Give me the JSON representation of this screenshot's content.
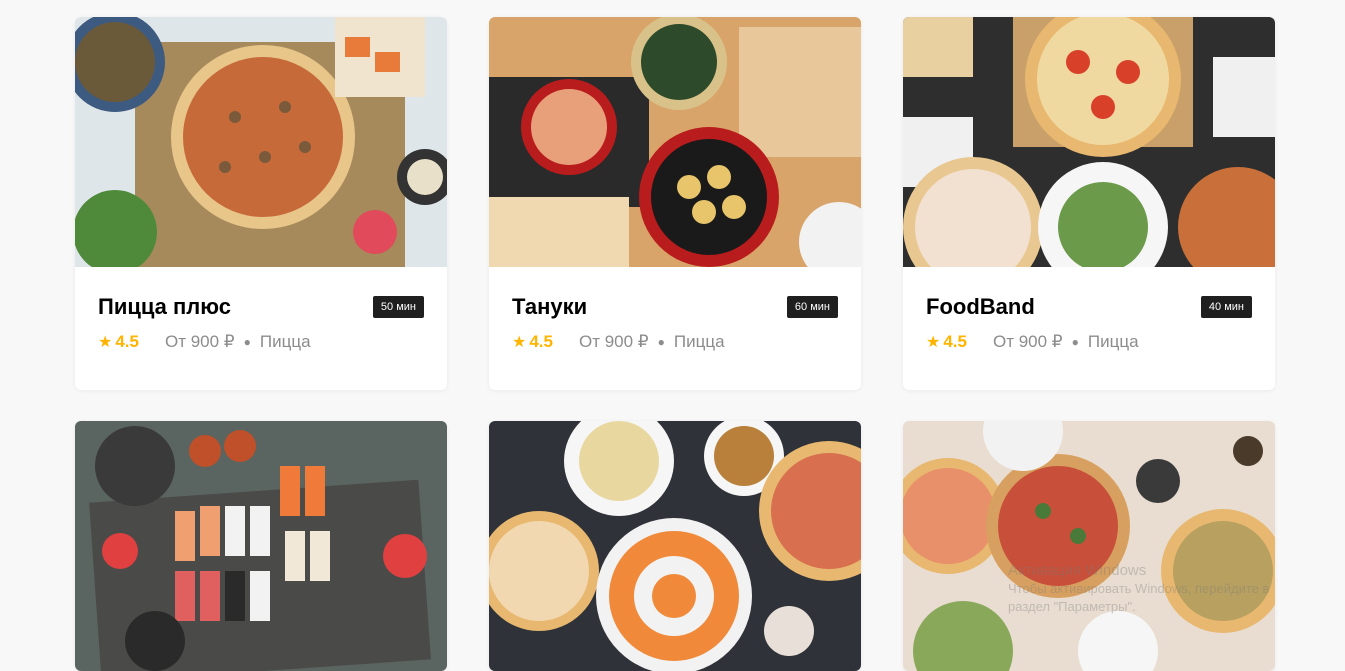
{
  "restaurants": [
    {
      "name": "Пицца плюс",
      "time": "50 мин",
      "rating": "4.5",
      "price": "От 900 ₽",
      "category": "Пицца",
      "image": "pizza-table-photo"
    },
    {
      "name": "Тануки",
      "time": "60 мин",
      "rating": "4.5",
      "price": "От 900 ₽",
      "category": "Пицца",
      "image": "asian-dishes-photo"
    },
    {
      "name": "FoodBand",
      "time": "40 мин",
      "rating": "4.5",
      "price": "От 900 ₽",
      "category": "Пицца",
      "image": "pizza-boxes-photo"
    },
    {
      "image": "sushi-board-photo"
    },
    {
      "image": "pizza-sushi-spread-photo"
    },
    {
      "image": "pizza-feast-photo"
    }
  ],
  "icons": {
    "star": "star-icon",
    "dot": "bullet-dot"
  },
  "colors": {
    "star": "#ffb400",
    "badge": "#1f1f1f",
    "background": "#f8f8f8"
  },
  "watermark": {
    "line1": "Активация Windows",
    "line2": "Чтобы активировать Windows, перейдите в",
    "line3": "раздел \"Параметры\"."
  }
}
